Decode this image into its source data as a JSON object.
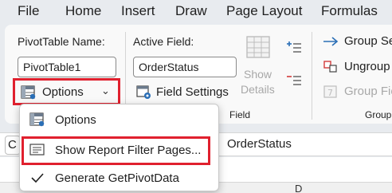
{
  "menu": {
    "tabs": [
      "File",
      "Home",
      "Insert",
      "Draw",
      "Page Layout",
      "Formulas"
    ]
  },
  "ribbon": {
    "pivot_name_label": "PivotTable Name:",
    "pivot_name_value": "PivotTable1",
    "options_label": "Options",
    "active_field_label": "Active Field:",
    "active_field_value": "OrderStatus",
    "field_settings_label": "Field Settings",
    "show_details_label_1": "Show",
    "show_details_label_2": "Details",
    "group_footer_label": "Field",
    "group_selection_label": "Group Se",
    "ungroup_label": "Ungroup",
    "group_field_label": "Group Fie",
    "group_footer_right": "Group"
  },
  "formula_bar": {
    "namebox_value": "C",
    "value": "OrderStatus"
  },
  "sheet": {
    "column_letter": "D"
  },
  "dropdown": {
    "items": [
      {
        "label": "Options",
        "icon": "pivot-options-icon"
      },
      {
        "label": "Show Report Filter Pages...",
        "icon": "report-filter-pages-icon"
      },
      {
        "label": "Generate GetPivotData",
        "icon": "checkmark-icon"
      }
    ]
  },
  "colors": {
    "highlight": "#e0202e",
    "accent": "#1a5fa8"
  }
}
